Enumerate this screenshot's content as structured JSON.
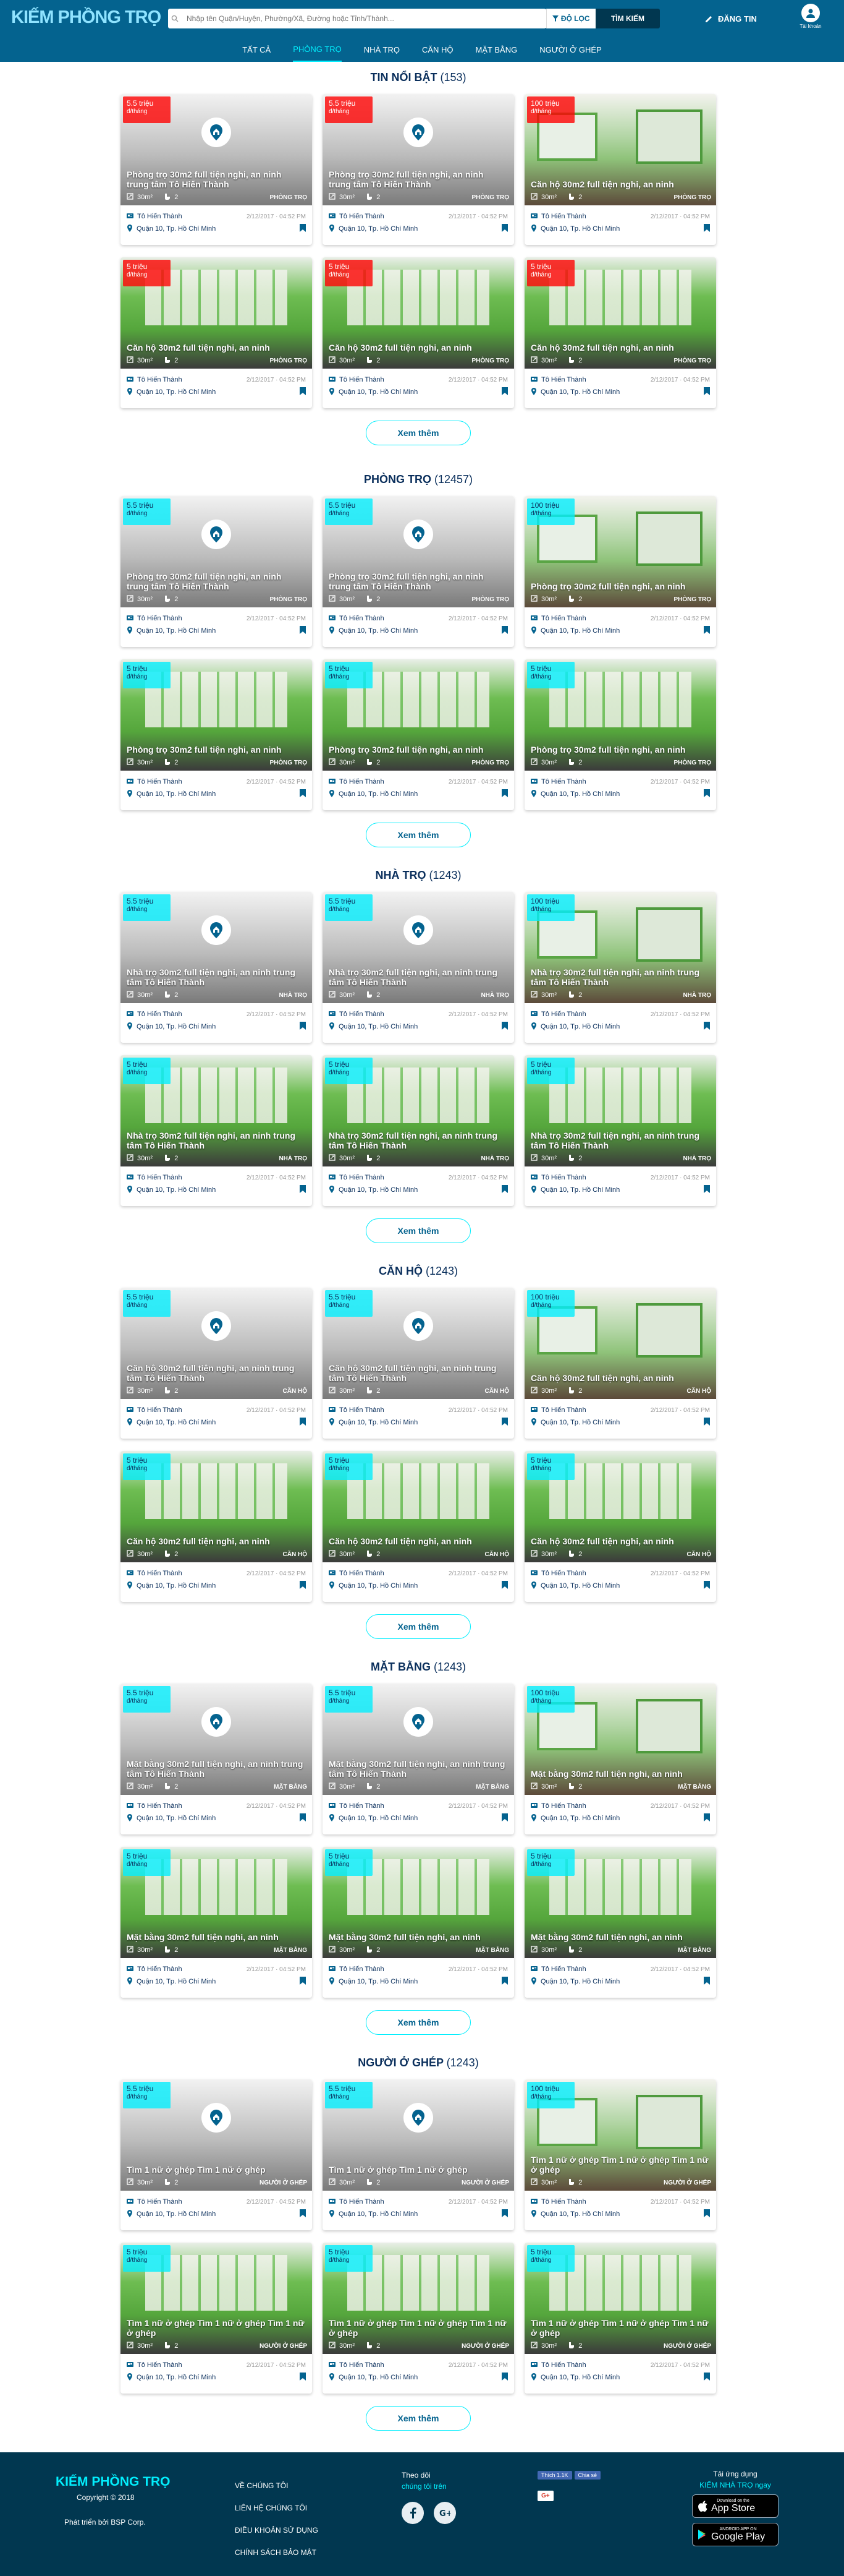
{
  "header": {
    "logo_a": "KIẾM PH",
    "logo_b": "ỒNG TRỌ",
    "search_placeholder": "Nhập tên Quận/Huyện, Phường/Xã, Đường hoặc Tỉnh/Thành...",
    "dropdown_label": "ĐỘ LỌC",
    "find_label": "TÌM KIẾM",
    "post_label": "ĐĂNG TIN",
    "user_label": "Tài khoản"
  },
  "nav": [
    "TẤT CẢ",
    "PHÒNG TRỌ",
    "NHÀ TRỌ",
    "CĂN HỘ",
    "MẶT BẰNG",
    "NGƯỜI Ở GHÉP"
  ],
  "more_label": "Xem thêm",
  "sections": [
    {
      "title": "TIN NỔI BẬT",
      "count": "(153)",
      "title_text": "Phòng trọ 30m2 full tiện nghi, an ninh trung tâm Tô Hiến Thành",
      "alt_title": "Căn hộ 30m2 full tiện nghi, an ninh",
      "type_label": "PHÒNG TRỌ",
      "price_color": "red"
    },
    {
      "title": "PHÒNG TRỌ",
      "count": "(12457)",
      "title_text": "Phòng trọ 30m2 full tiện nghi, an ninh trung tâm Tô Hiến Thành",
      "alt_title": "Phòng trọ 30m2 full tiện nghi, an ninh",
      "type_label": "PHÒNG TRỌ",
      "price_color": "cyan"
    },
    {
      "title": "NHÀ TRỌ",
      "count": "(1243)",
      "title_text": "Nhà trọ 30m2 full tiện nghi, an ninh trung tâm Tô Hiến Thành",
      "alt_title": "Nhà trọ 30m2 full tiện nghi, an ninh trung tâm Tô Hiến Thành",
      "type_label": "NHÀ TRỌ",
      "price_color": "cyan"
    },
    {
      "title": "CĂN HỘ",
      "count": "(1243)",
      "title_text": "Căn hộ 30m2 full tiện nghi, an ninh trung tâm Tô Hiến Thành",
      "alt_title": "Căn hộ 30m2 full tiện nghi, an ninh",
      "type_label": "CĂN HỘ",
      "price_color": "cyan"
    },
    {
      "title": "MẶT BẰNG",
      "count": "(1243)",
      "title_text": "Mặt bằng 30m2 full tiện nghi, an ninh trung tâm Tô Hiến Thành",
      "alt_title": "Mặt bằng 30m2 full tiện nghi, an ninh",
      "type_label": "MẶT BẰNG",
      "price_color": "cyan"
    },
    {
      "title": "NGƯỜI Ở GHÉP",
      "count": "(1243)",
      "title_text": "Tìm 1 nữ ở ghép Tìm 1 nữ ở ghép",
      "alt_title": "Tìm 1 nữ ở ghép Tìm 1 nữ ở ghép Tìm 1 nữ ở ghép",
      "type_label": "NGƯỜI Ở GHÉP",
      "price_color": "cyan"
    }
  ],
  "card": {
    "prices": [
      "5.5 triệu",
      "5.5 triệu",
      "100 triệu",
      "5 triệu",
      "5 triệu",
      "5 triệu"
    ],
    "unit": "đ/tháng",
    "area": "30m²",
    "rooms": "2",
    "owner": "Tô Hiến Thành",
    "date": "2/12/2017 · 04:52 PM",
    "address": "Quận 10, Tp. Hồ Chí Minh"
  },
  "footer": {
    "logo": "KIẾM PHỒNG TRỌ",
    "copyright": "Copyright © 2018",
    "developer": "Phát triển bởi BSP Corp.",
    "links": [
      "VỀ CHÚNG TÔI",
      "LIÊN HỆ CHÚNG TÔI",
      "ĐIỀU KHOẢN SỬ DỤNG",
      "CHÍNH SÁCH BẢO MẬT"
    ],
    "follow": "Theo dõi",
    "follow_sub": "chúng tôi trên",
    "fb_like": "Thích 1.1K",
    "fb_share": "Chia sẻ",
    "gplus": "G+",
    "app_title": "Tải ứng dụng",
    "app_sub": "KIẾM NHÀ TRỌ ngay",
    "appstore_small": "Download on the",
    "appstore": "App Store",
    "gplay_small": "ANDROID APP ON",
    "gplay": "Google Play"
  }
}
